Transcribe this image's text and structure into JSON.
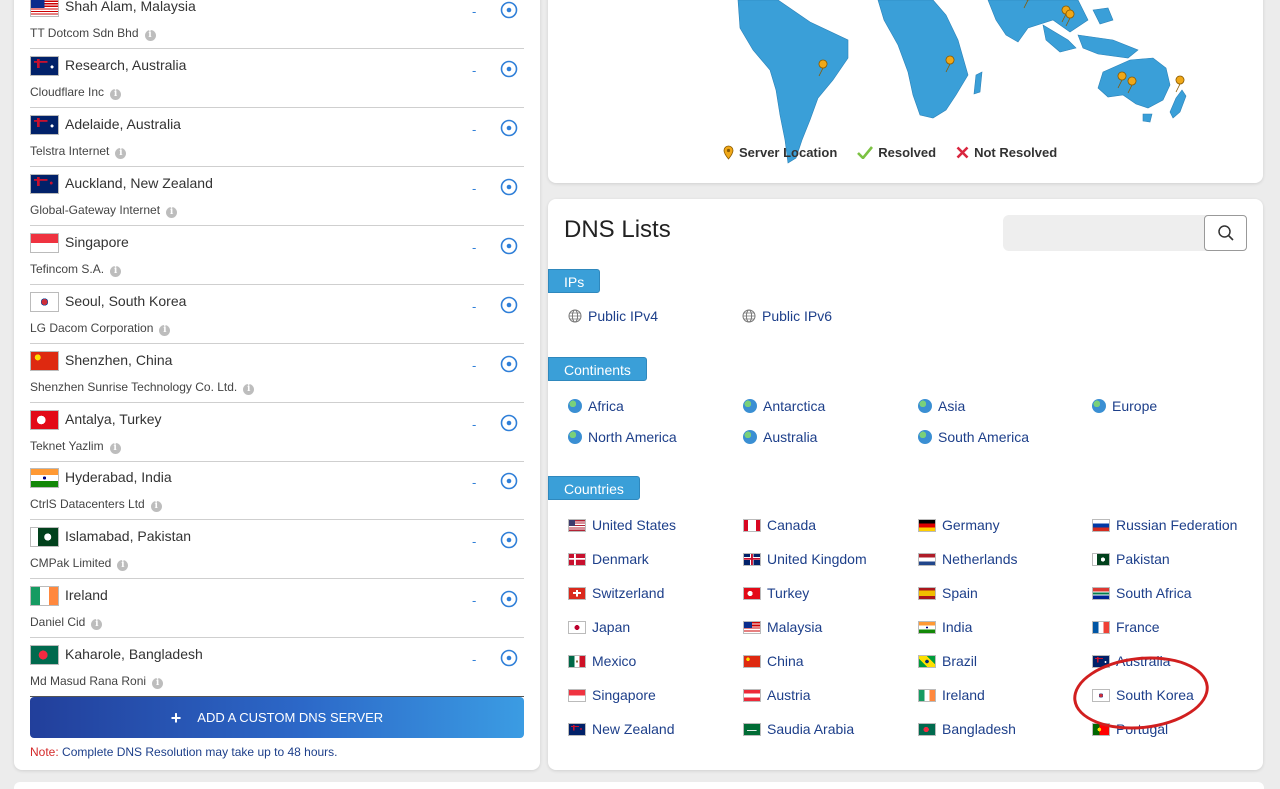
{
  "servers": [
    {
      "city": "Shah Alam, Malaysia",
      "provider": "TT Dotcom Sdn Bhd",
      "status": "-",
      "flag": "my"
    },
    {
      "city": "Research, Australia",
      "provider": "Cloudflare Inc",
      "status": "-",
      "flag": "au"
    },
    {
      "city": "Adelaide, Australia",
      "provider": "Telstra Internet",
      "status": "-",
      "flag": "au"
    },
    {
      "city": "Auckland, New Zealand",
      "provider": "Global-Gateway Internet",
      "status": "-",
      "flag": "nz"
    },
    {
      "city": "Singapore",
      "provider": "Tefincom S.A.",
      "status": "-",
      "flag": "sg"
    },
    {
      "city": "Seoul, South Korea",
      "provider": "LG Dacom Corporation",
      "status": "-",
      "flag": "kr"
    },
    {
      "city": "Shenzhen, China",
      "provider": "Shenzhen Sunrise Technology Co. Ltd.",
      "status": "-",
      "flag": "cn"
    },
    {
      "city": "Antalya, Turkey",
      "provider": "Teknet Yazlim",
      "status": "-",
      "flag": "tr"
    },
    {
      "city": "Hyderabad, India",
      "provider": "CtrlS Datacenters Ltd",
      "status": "-",
      "flag": "in"
    },
    {
      "city": "Islamabad, Pakistan",
      "provider": "CMPak Limited",
      "status": "-",
      "flag": "pk"
    },
    {
      "city": "Ireland",
      "provider": "Daniel Cid",
      "status": "-",
      "flag": "ie"
    },
    {
      "city": "Kaharole, Bangladesh",
      "provider": "Md Masud Rana Roni",
      "status": "-",
      "flag": "bd"
    }
  ],
  "custom_button": {
    "label": "ADD A CUSTOM DNS SERVER",
    "icon": "+"
  },
  "note": {
    "label": "Note:",
    "text": " Complete DNS Resolution may take up to 48 hours."
  },
  "map_legend": {
    "server_location": "Server Location",
    "resolved": "Resolved",
    "not_resolved": "Not Resolved"
  },
  "dns_lists": {
    "title": "DNS Lists",
    "search": {
      "placeholder": "",
      "value": ""
    },
    "ips_label": "IPs",
    "ips": [
      "Public IPv4",
      "Public IPv6"
    ],
    "continents_label": "Continents",
    "continents": [
      "Africa",
      "Antarctica",
      "Asia",
      "Europe",
      "North America",
      "Australia",
      "South America"
    ],
    "countries_label": "Countries",
    "countries": [
      {
        "name": "United States",
        "flag": "us"
      },
      {
        "name": "Canada",
        "flag": "ca"
      },
      {
        "name": "Germany",
        "flag": "de"
      },
      {
        "name": "Russian Federation",
        "flag": "ru"
      },
      {
        "name": "Denmark",
        "flag": "dk"
      },
      {
        "name": "United Kingdom",
        "flag": "gb"
      },
      {
        "name": "Netherlands",
        "flag": "nl"
      },
      {
        "name": "Pakistan",
        "flag": "pk"
      },
      {
        "name": "Switzerland",
        "flag": "ch"
      },
      {
        "name": "Turkey",
        "flag": "tr"
      },
      {
        "name": "Spain",
        "flag": "es"
      },
      {
        "name": "South Africa",
        "flag": "za"
      },
      {
        "name": "Japan",
        "flag": "jp"
      },
      {
        "name": "Malaysia",
        "flag": "my"
      },
      {
        "name": "India",
        "flag": "in"
      },
      {
        "name": "France",
        "flag": "fr"
      },
      {
        "name": "Mexico",
        "flag": "mx"
      },
      {
        "name": "China",
        "flag": "cn"
      },
      {
        "name": "Brazil",
        "flag": "br"
      },
      {
        "name": "Australia",
        "flag": "au"
      },
      {
        "name": "Singapore",
        "flag": "sg"
      },
      {
        "name": "Austria",
        "flag": "at"
      },
      {
        "name": "Ireland",
        "flag": "ie"
      },
      {
        "name": "South Korea",
        "flag": "kr"
      },
      {
        "name": "New Zealand",
        "flag": "nz"
      },
      {
        "name": "Saudia Arabia",
        "flag": "sa"
      },
      {
        "name": "Bangladesh",
        "flag": "bd"
      },
      {
        "name": "Portugal",
        "flag": "pt"
      }
    ]
  },
  "colors": {
    "accent": "#3a9fd8",
    "link": "#1d3f8a",
    "pin": "#f0a818",
    "resolved": "#7cc243",
    "not_resolved": "#d9263f",
    "highlight": "#d11f1f",
    "map_land": "#3a9fd8"
  }
}
